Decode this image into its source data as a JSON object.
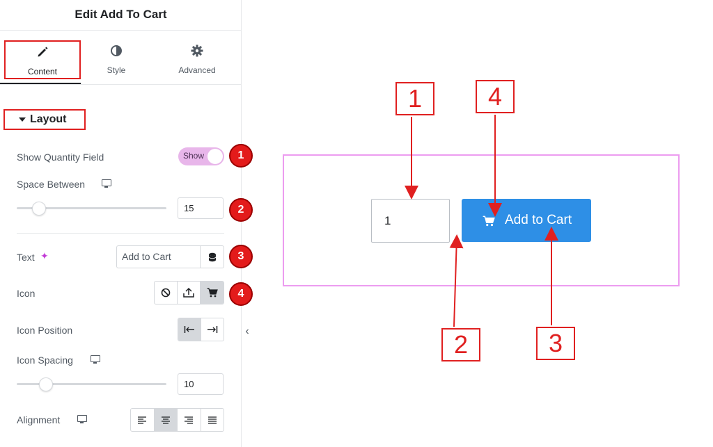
{
  "panel": {
    "title": "Edit Add To Cart",
    "tabs": [
      {
        "label": "Content",
        "icon": "pencil-icon"
      },
      {
        "label": "Style",
        "icon": "half-circle-icon"
      },
      {
        "label": "Advanced",
        "icon": "gear-icon"
      }
    ],
    "section_title": "Layout",
    "controls": {
      "show_quantity": {
        "label": "Show Quantity Field",
        "toggle_text": "Show",
        "value": true
      },
      "space_between": {
        "label": "Space Between",
        "value": "15",
        "slider_fraction": 0.1
      },
      "text": {
        "label": "Text",
        "value": "Add to Cart"
      },
      "icon": {
        "label": "Icon",
        "options": [
          "ban-icon",
          "upload-icon",
          "cart-icon"
        ],
        "selected": "cart-icon"
      },
      "icon_position": {
        "label": "Icon Position",
        "options": [
          "align-start-icon",
          "align-end-icon"
        ],
        "selected": "align-start-icon"
      },
      "icon_spacing": {
        "label": "Icon Spacing",
        "value": "10",
        "slider_fraction": 0.15
      },
      "alignment": {
        "label": "Alignment",
        "options": [
          "align-left-icon",
          "align-center-icon",
          "align-right-icon",
          "justify-icon"
        ],
        "selected": "align-center-icon"
      }
    },
    "badges": [
      "1",
      "2",
      "3",
      "4"
    ]
  },
  "preview": {
    "quantity_value": "1",
    "button_label": "Add to Cart",
    "button_icon": "cart-icon",
    "callouts": [
      "1",
      "4",
      "2",
      "3"
    ]
  },
  "colors": {
    "accent_red": "#e02020",
    "badge_red": "#e31b1b",
    "button_blue": "#2e8fe6",
    "toggle_pink": "#e8b6ea",
    "frame_pink": "#ec9cf0"
  }
}
